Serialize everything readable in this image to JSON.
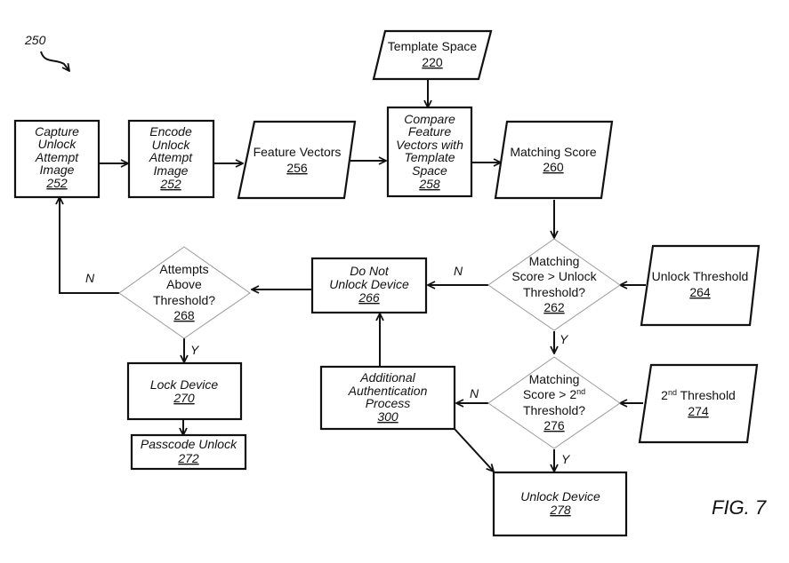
{
  "diagram": {
    "ref_number": "250",
    "figure_label": "FIG. 7",
    "nodes": {
      "capture": {
        "lines": [
          "Capture",
          "Unlock",
          "Attempt",
          "Image"
        ],
        "ref": "252"
      },
      "encode": {
        "lines": [
          "Encode",
          "Unlock",
          "Attempt",
          "Image"
        ],
        "ref": "252"
      },
      "feature_vectors": {
        "lines": [
          "Feature Vectors"
        ],
        "ref": "256"
      },
      "template_space": {
        "lines": [
          "Template Space"
        ],
        "ref": "220"
      },
      "compare": {
        "lines": [
          "Compare",
          "Feature",
          "Vectors with",
          "Template",
          "Space"
        ],
        "ref": "258"
      },
      "matching_score": {
        "lines": [
          "Matching Score"
        ],
        "ref": "260"
      },
      "decision_unlock": {
        "lines": [
          "Matching",
          "Score > Unlock",
          "Threshold?"
        ],
        "ref": "262"
      },
      "unlock_threshold": {
        "lines": [
          "Unlock Threshold"
        ],
        "ref": "264"
      },
      "do_not_unlock": {
        "lines": [
          "Do Not",
          "Unlock Device"
        ],
        "ref": "266"
      },
      "attempts": {
        "lines": [
          "Attempts",
          "Above",
          "Threshold?"
        ],
        "ref": "268"
      },
      "lock_device": {
        "lines": [
          "Lock Device"
        ],
        "ref": "270"
      },
      "passcode": {
        "lines": [
          "Passcode Unlock"
        ],
        "ref": "272"
      },
      "decision_second": {
        "line1": "Matching",
        "line2_pre": "Score > 2",
        "line2_sup": "nd",
        "line3": "Threshold?",
        "ref": "276"
      },
      "second_threshold": {
        "pre": "2",
        "sup": "nd",
        "post": " Threshold",
        "ref": "274"
      },
      "additional_auth": {
        "lines": [
          "Additional",
          "Authentication",
          "Process"
        ],
        "ref": "300"
      },
      "unlock_device": {
        "lines": [
          "Unlock Device"
        ],
        "ref": "278"
      }
    },
    "edge_labels": {
      "attempts_no": "N",
      "attempts_yes": "Y",
      "unlock_no": "N",
      "unlock_yes": "Y",
      "second_no": "N",
      "second_yes": "Y"
    }
  }
}
